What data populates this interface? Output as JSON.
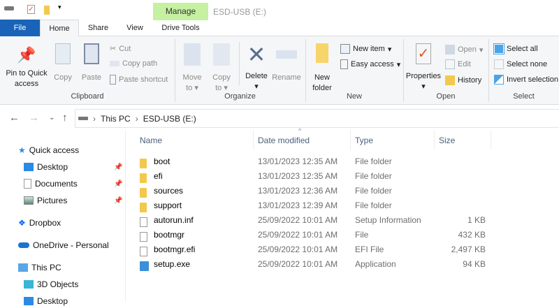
{
  "title": {
    "manage": "Manage",
    "window_title": "ESD-USB (E:)"
  },
  "tabs": [
    "File",
    "Home",
    "Share",
    "View",
    "Drive Tools"
  ],
  "ribbon": {
    "clipboard": {
      "pin": [
        "Pin to Quick",
        "access"
      ],
      "copy": "Copy",
      "paste": "Paste",
      "cut": "Cut",
      "copy_path": "Copy path",
      "paste_shortcut": "Paste shortcut",
      "group": "Clipboard"
    },
    "organize": {
      "move_to": [
        "Move",
        "to"
      ],
      "copy_to": [
        "Copy",
        "to"
      ],
      "delete": "Delete",
      "rename": "Rename",
      "group": "Organize"
    },
    "new": {
      "new_folder": [
        "New",
        "folder"
      ],
      "new_item": "New item",
      "easy_access": "Easy access",
      "group": "New"
    },
    "open": {
      "properties": "Properties",
      "open": "Open",
      "edit": "Edit",
      "history": "History",
      "group": "Open"
    },
    "select": {
      "select_all": "Select all",
      "select_none": "Select none",
      "invert": "Invert selection",
      "group": "Select"
    }
  },
  "address": {
    "crumbs": [
      "This PC",
      "ESD-USB (E:)"
    ]
  },
  "nav": {
    "quick_access": "Quick access",
    "desktop": "Desktop",
    "documents": "Documents",
    "pictures": "Pictures",
    "dropbox": "Dropbox",
    "onedrive": "OneDrive - Personal",
    "this_pc": "This PC",
    "objects3d": "3D Objects",
    "desktop2": "Desktop"
  },
  "columns": {
    "name": "Name",
    "date": "Date modified",
    "type": "Type",
    "size": "Size"
  },
  "files": [
    {
      "name": "boot",
      "date": "13/01/2023 12:35 AM",
      "type": "File folder",
      "size": ""
    },
    {
      "name": "efi",
      "date": "13/01/2023 12:35 AM",
      "type": "File folder",
      "size": ""
    },
    {
      "name": "sources",
      "date": "13/01/2023 12:36 AM",
      "type": "File folder",
      "size": ""
    },
    {
      "name": "support",
      "date": "13/01/2023 12:39 AM",
      "type": "File folder",
      "size": ""
    },
    {
      "name": "autorun.inf",
      "date": "25/09/2022 10:01 AM",
      "type": "Setup Information",
      "size": "1 KB"
    },
    {
      "name": "bootmgr",
      "date": "25/09/2022 10:01 AM",
      "type": "File",
      "size": "432 KB"
    },
    {
      "name": "bootmgr.efi",
      "date": "25/09/2022 10:01 AM",
      "type": "EFI File",
      "size": "2,497 KB"
    },
    {
      "name": "setup.exe",
      "date": "25/09/2022 10:01 AM",
      "type": "Application",
      "size": "94 KB"
    }
  ]
}
